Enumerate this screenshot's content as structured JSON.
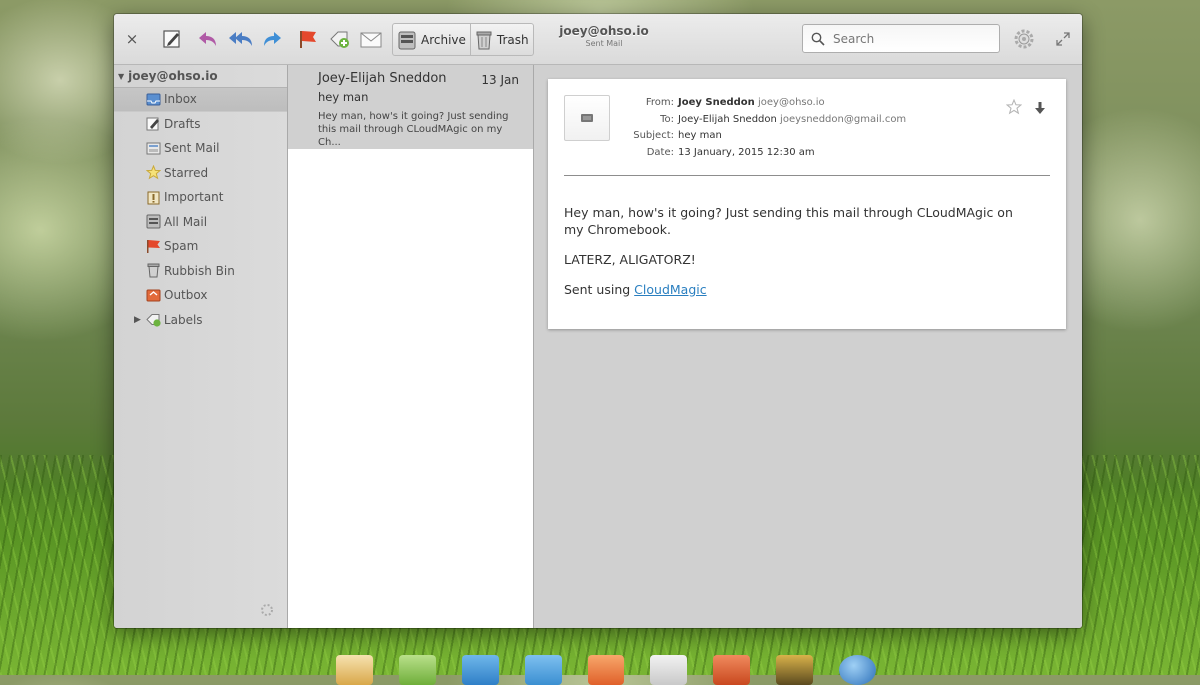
{
  "toolbar": {
    "close_label": "×",
    "archive_label": "Archive",
    "trash_label": "Trash",
    "account_email": "joey@ohso.io",
    "account_folder": "Sent Mail",
    "search_placeholder": "Search"
  },
  "sidebar": {
    "account": "joey@ohso.io",
    "folders": [
      {
        "label": "Inbox",
        "icon": "inbox-icon",
        "selected": true
      },
      {
        "label": "Drafts",
        "icon": "drafts-icon"
      },
      {
        "label": "Sent Mail",
        "icon": "sent-mail-icon"
      },
      {
        "label": "Starred",
        "icon": "star-icon"
      },
      {
        "label": "Important",
        "icon": "important-icon"
      },
      {
        "label": "All Mail",
        "icon": "all-mail-icon"
      },
      {
        "label": "Spam",
        "icon": "spam-flag-icon"
      },
      {
        "label": "Rubbish Bin",
        "icon": "rubbish-bin-icon"
      },
      {
        "label": "Outbox",
        "icon": "outbox-icon"
      },
      {
        "label": "Labels",
        "icon": "labels-icon"
      }
    ]
  },
  "message_list": [
    {
      "sender": "Joey-Elijah Sneddon",
      "date": "13 Jan",
      "subject": "hey man",
      "preview": "Hey man, how's it going? Just sending this mail through CLoudMAgic on my Ch..."
    }
  ],
  "reader": {
    "from_label": "From:",
    "from_name": "Joey Sneddon",
    "from_addr": "joey@ohso.io",
    "to_label": "To:",
    "to_name": "Joey-Elijah Sneddon",
    "to_addr": "joeysneddon@gmail.com",
    "subject_label": "Subject:",
    "subject": "hey man",
    "date_label": "Date:",
    "date": "13 January, 2015 12:30 am",
    "body_line1": "Hey man, how's it going? Just sending this mail through CLoudMAgic on my Chromebook.",
    "body_line2": "LATERZ, ALIGATORZ!",
    "signature_prefix": "Sent using ",
    "signature_link": "CloudMagic"
  },
  "colors": {
    "window_bg": "#d6d6d6",
    "selected_row": "#d0d0d0",
    "link": "#2a7fc0",
    "flag_red": "#e4482c",
    "reply_purple": "#b05aa6",
    "forward_blue": "#3f8fd6"
  }
}
